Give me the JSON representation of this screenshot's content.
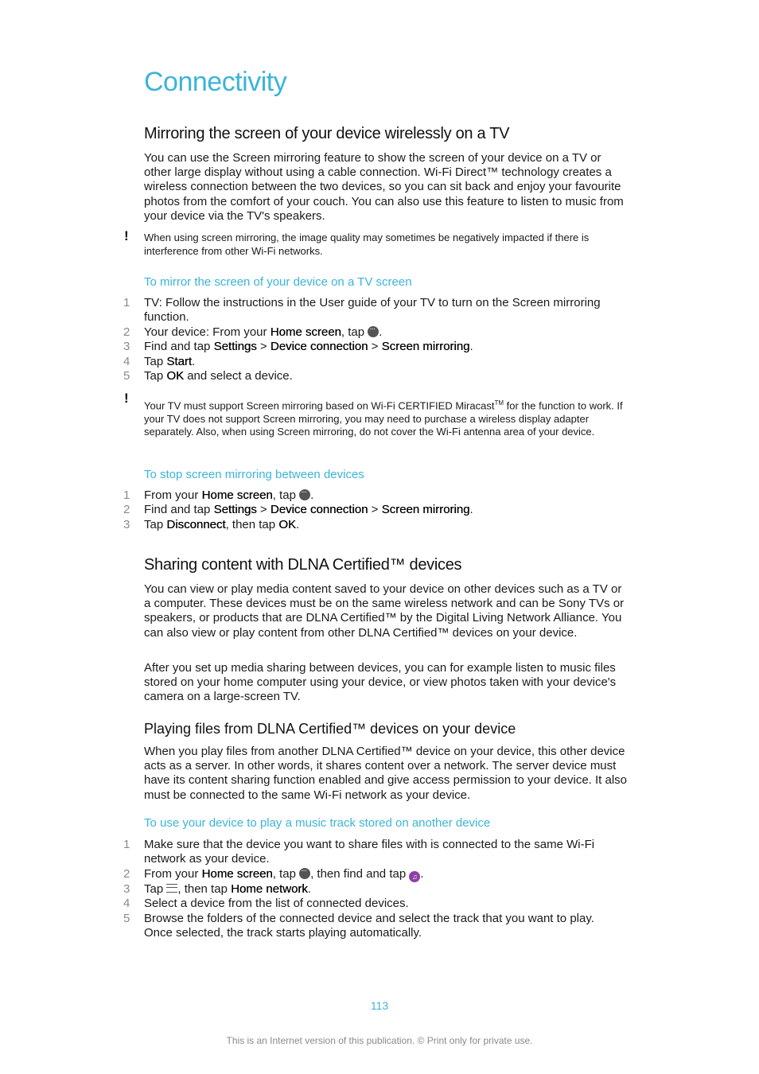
{
  "page_title": "Connectivity",
  "section_mirroring": {
    "heading": "Mirroring the screen of your device wirelessly on a TV",
    "body": "You can use the Screen mirroring feature to show the screen of your device on a TV or other large display without using a cable connection. Wi-Fi Direct™ technology creates a wireless connection between the two devices, so you can sit back and enjoy your favourite photos from the comfort of your couch. You can also use this feature to listen to music from your device via the TV's speakers.",
    "note1": "When using screen mirroring, the image quality may sometimes be negatively impacted if there is interference from other Wi-Fi networks.",
    "proc1_title": "To mirror the screen of your device on a TV screen",
    "proc1_steps": {
      "s1": "TV: Follow the instructions in the User guide of your TV to turn on the Screen mirroring function.",
      "s2_pre": "Your device: From your ",
      "s2_b1": "Home screen",
      "s2_mid": ", tap ",
      "s2_end": ".",
      "s3_pre": "Find and tap ",
      "s3_b1": "Settings",
      "sep": " > ",
      "s3_b2": "Device connection",
      "s3_b3": "Screen mirroring",
      "s3_end": ".",
      "s4_pre": "Tap ",
      "s4_b1": "Start",
      "s4_end": ".",
      "s5_pre": "Tap ",
      "s5_b1": "OK",
      "s5_end": " and select a device."
    },
    "note2_pre": "Your TV must support Screen mirroring based on Wi-Fi CERTIFIED Miracast",
    "note2_tm": "TM",
    "note2_post": " for the function to work. If your TV does not support Screen mirroring, you may need to purchase a wireless display adapter separately. Also, when using Screen mirroring, do not cover the Wi-Fi antenna area of your device.",
    "proc2_title": "To stop screen mirroring between devices",
    "proc2_steps": {
      "s1_pre": "From your ",
      "s1_b1": "Home screen",
      "s1_mid": ", tap ",
      "s1_end": ".",
      "s2_pre": "Find and tap ",
      "s2_b1": "Settings",
      "s2_b2": "Device connection",
      "s2_b3": "Screen mirroring",
      "s2_end": ".",
      "s3_pre": "Tap ",
      "s3_b1": "Disconnect",
      "s3_mid": ", then tap ",
      "s3_b2": "OK",
      "s3_end": "."
    }
  },
  "section_dlna": {
    "heading": "Sharing content with DLNA Certified™ devices",
    "body1": "You can view or play media content saved to your device on other devices such as a TV or a computer. These devices must be on the same wireless network and can be Sony TVs or speakers, or products that are DLNA Certified™ by the Digital Living Network Alliance. You can also view or play content from other DLNA Certified™ devices on your device.",
    "body2": "After you set up media sharing between devices, you can for example listen to music files stored on your home computer using your device, or view photos taken with your device's camera on a large-screen TV.",
    "sub_heading": "Playing files from DLNA Certified™ devices on your device",
    "sub_body": "When you play files from another DLNA Certified™ device on your device, this other device acts as a server. In other words, it shares content over a network. The server device must have its content sharing function enabled and give access permission to your device. It also must be connected to the same Wi-Fi network as your device.",
    "proc_title": "To use your device to play a music track stored on another device",
    "steps": {
      "s1": "Make sure that the device you want to share files with is connected to the same Wi-Fi network as your device.",
      "s2_pre": "From your ",
      "s2_b1": "Home screen",
      "s2_mid": ", tap ",
      "s2_mid2": ", then find and tap ",
      "s2_end": ".",
      "s3_pre": "Tap ",
      "s3_mid": ", then tap ",
      "s3_b1": "Home network",
      "s3_end": ".",
      "s4": "Select a device from the list of connected devices.",
      "s5": "Browse the folders of the connected device and select the track that you want to play. Once selected, the track starts playing automatically."
    }
  },
  "step_numbers": [
    "1",
    "2",
    "3",
    "4",
    "5"
  ],
  "icons": {
    "apps": "apps-grid-icon",
    "music": "music-app-icon",
    "menu": "menu-icon",
    "note": "exclamation-icon"
  },
  "colors": {
    "accent": "#3bb4d8",
    "music_icon": "#8e3fa6"
  },
  "page_number": "113",
  "footer": "This is an Internet version of this publication. © Print only for private use."
}
